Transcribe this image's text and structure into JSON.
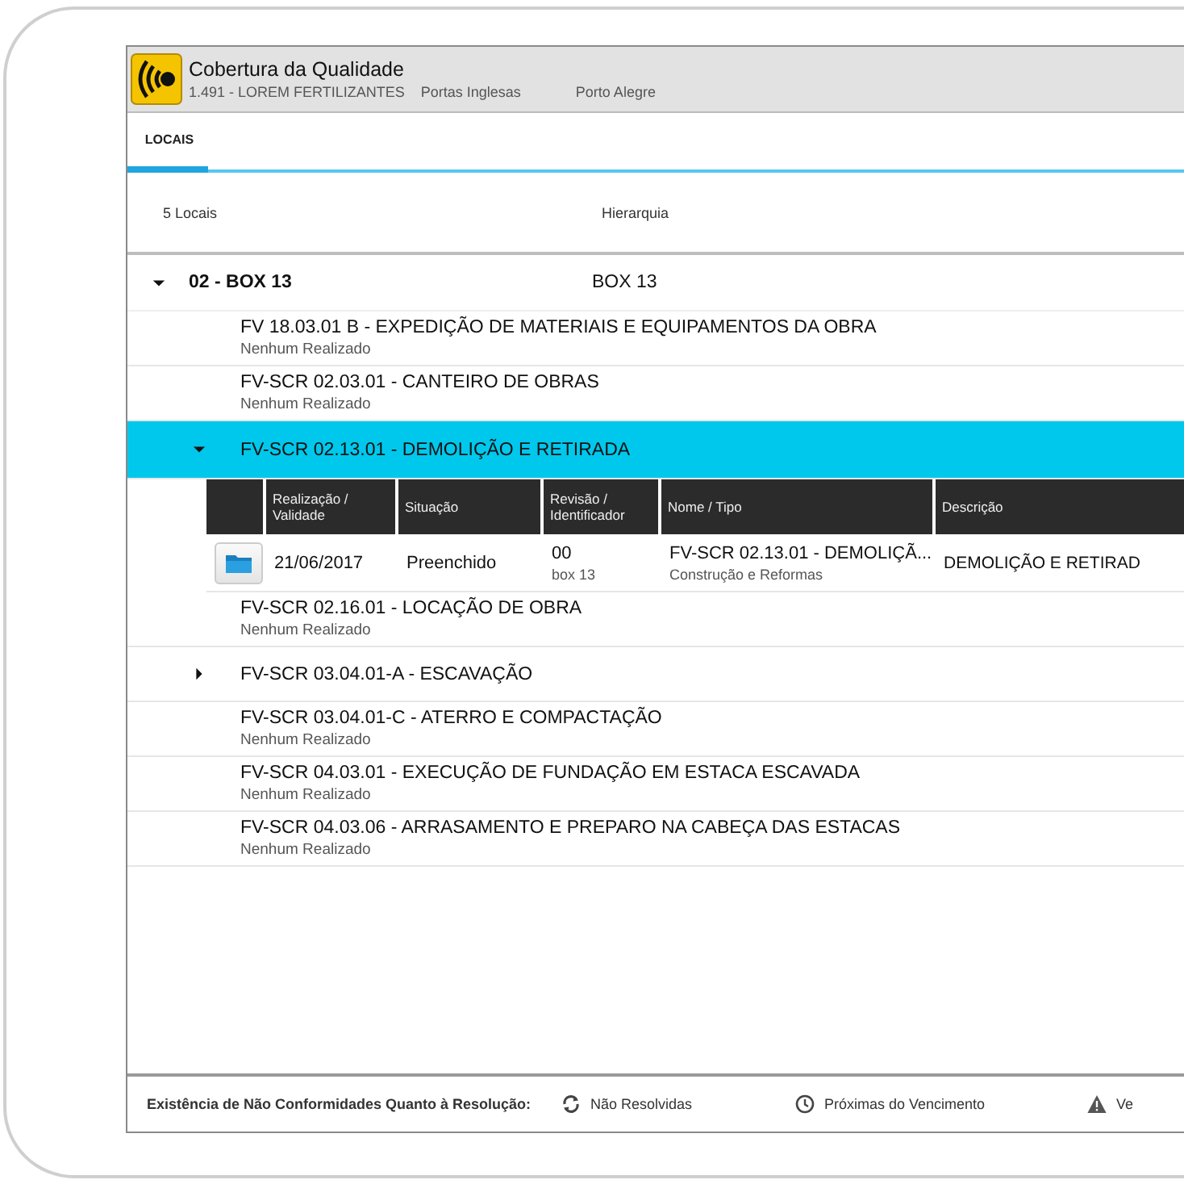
{
  "header": {
    "title": "Cobertura da Qualidade",
    "code": "1.491  -  LOREM FERTILIZANTES",
    "place": "Portas Inglesas",
    "city": "Porto Alegre"
  },
  "tabs": [
    {
      "label": "LOCAIS",
      "selected": true
    }
  ],
  "list_header": {
    "count": "5 Locais",
    "hierarchy": "Hierarquia"
  },
  "tree": [
    {
      "title": "02 - BOX 13",
      "hierarchy": "BOX 13",
      "expanded": true,
      "children": [
        {
          "kind": "leaf",
          "title": "FV 18.03.01 B - EXPEDIÇÃO DE MATERIAIS E EQUIPAMENTOS DA OBRA",
          "status": "Nenhum Realizado"
        },
        {
          "kind": "leaf",
          "title": "FV-SCR 02.03.01 - CANTEIRO DE OBRAS",
          "status": "Nenhum Realizado"
        },
        {
          "kind": "node",
          "title": "FV-SCR 02.13.01 - DEMOLIÇÃO E RETIRADA",
          "expanded": true,
          "selected": true,
          "table": {
            "columns": [
              "",
              "Realização / Validade",
              "Situação",
              "Revisão / Identificador",
              "Nome / Tipo",
              "Descrição"
            ],
            "rows": [
              {
                "date": "21/06/2017",
                "situation": "Preenchido",
                "revision": "00",
                "identifier": "box 13",
                "name": "FV-SCR 02.13.01 - DEMOLIÇÃ...",
                "type": "Construção e Reformas",
                "description": "DEMOLIÇÃO E RETIRAD"
              }
            ]
          }
        },
        {
          "kind": "leaf",
          "title": "FV-SCR 02.16.01 - LOCAÇÃO DE OBRA",
          "status": "Nenhum Realizado"
        },
        {
          "kind": "node",
          "title": "FV-SCR 03.04.01-A - ESCAVAÇÃO",
          "expanded": false,
          "selected": false
        },
        {
          "kind": "leaf",
          "title": "FV-SCR 03.04.01-C - ATERRO E COMPACTAÇÃO",
          "status": "Nenhum Realizado"
        },
        {
          "kind": "leaf",
          "title": "FV-SCR 04.03.01 - EXECUÇÃO DE FUNDAÇÃO EM ESTACA ESCAVADA",
          "status": "Nenhum Realizado"
        },
        {
          "kind": "leaf",
          "title": "FV-SCR 04.03.06 - ARRASAMENTO E PREPARO NA CABEÇA DAS ESTACAS",
          "status": "Nenhum Realizado"
        }
      ]
    }
  ],
  "footer": {
    "label": "Existência de Não Conformidades Quanto à Resolução:",
    "legend": [
      {
        "kind": "refresh",
        "label": "Não Resolvidas"
      },
      {
        "kind": "clock",
        "label": "Próximas do Vencimento"
      },
      {
        "kind": "warning",
        "label": "Ve"
      }
    ]
  }
}
